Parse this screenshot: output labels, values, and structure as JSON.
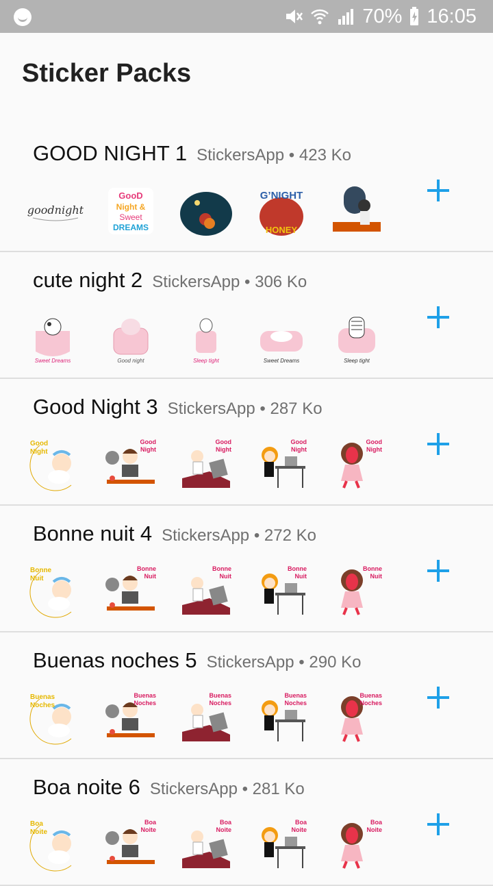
{
  "status": {
    "battery": "70%",
    "time": "16:05"
  },
  "header": {
    "title": "Sticker Packs"
  },
  "packs": [
    {
      "name": "GOOD NIGHT 1",
      "publisher": "StickersApp",
      "size": "423 Ko",
      "theme": "night",
      "stickers": [
        "goodnight-script",
        "good-night-sweet-dreams",
        "night-moon-girl",
        "gnight-honey",
        "desk-boy"
      ]
    },
    {
      "name": "cute night 2",
      "publisher": "StickersApp",
      "size": "306 Ko",
      "theme": "pink",
      "stickers": [
        "cow-cup",
        "bear-chair",
        "bunny-cup",
        "cat-sofa",
        "zebra-chair"
      ]
    },
    {
      "name": "Good Night 3",
      "publisher": "StickersApp",
      "size": "287 Ko",
      "theme": "worker",
      "caption": [
        "Good",
        "Night"
      ],
      "stickers": [
        "baby-moon",
        "office-man",
        "man-laptop",
        "girl-desk",
        "pink-girl"
      ]
    },
    {
      "name": "Bonne nuit 4",
      "publisher": "StickersApp",
      "size": "272 Ko",
      "theme": "worker",
      "caption": [
        "Bonne",
        "Nuit"
      ],
      "stickers": [
        "baby-moon",
        "office-man",
        "man-laptop",
        "girl-desk",
        "pink-girl"
      ]
    },
    {
      "name": "Buenas noches 5",
      "publisher": "StickersApp",
      "size": "290 Ko",
      "theme": "worker",
      "caption": [
        "Buenas",
        "Noches"
      ],
      "stickers": [
        "baby-moon",
        "office-man",
        "man-laptop",
        "girl-desk",
        "pink-girl"
      ]
    },
    {
      "name": "Boa noite 6",
      "publisher": "StickersApp",
      "size": "281 Ko",
      "theme": "worker",
      "caption": [
        "Boa",
        "Noite"
      ],
      "stickers": [
        "baby-moon",
        "office-man",
        "man-laptop",
        "girl-desk",
        "pink-girl"
      ]
    }
  ],
  "colors": {
    "accent": "#1ea0e8",
    "statusbar": "#b3b3b3"
  },
  "icons": {
    "add": "plus-icon",
    "mute": "mute-icon",
    "wifi": "wifi-icon",
    "signal": "signal-icon",
    "battery": "battery-icon"
  }
}
